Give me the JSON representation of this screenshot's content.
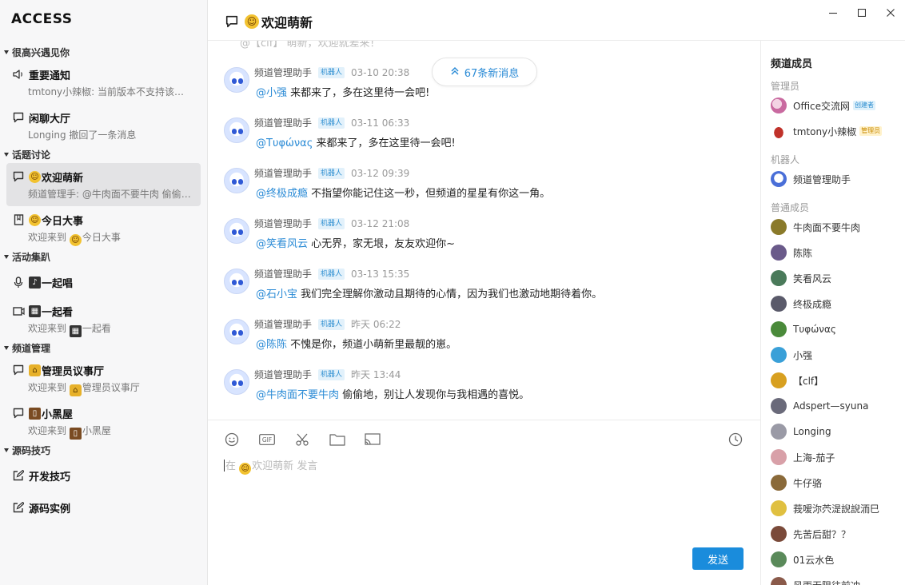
{
  "app": {
    "title": "ACCESS"
  },
  "sidebar": {
    "groups": [
      {
        "title": "很高兴遇见你",
        "channels": [
          {
            "name": "重要通知",
            "sub": "tmtony小辣椒: 当前版本不支持该消息类型，请使用最新版本..."
          },
          {
            "name": "闲聊大厅",
            "sub": "Longing 撤回了一条消息"
          }
        ]
      },
      {
        "title": "话题讨论",
        "channels": [
          {
            "name": "欢迎萌新",
            "sub": "频道管理手: @牛肉面不要牛肉 偷偷地，别让人发现你与我相遇的喜悦。"
          },
          {
            "name": "今日大事",
            "sub_prefix": "欢迎来到",
            "sub_name": "今日大事"
          }
        ]
      },
      {
        "title": "活动集趴",
        "channels": [
          {
            "name": "一起唱"
          },
          {
            "name": "一起看",
            "sub_prefix": "欢迎来到",
            "sub_name": "一起看"
          }
        ]
      },
      {
        "title": "频道管理",
        "channels": [
          {
            "name": "管理员议事厅",
            "sub_prefix": "欢迎来到",
            "sub_name": "管理员议事厅"
          },
          {
            "name": "小黑屋",
            "sub_prefix": "欢迎来到",
            "sub_name": "小黑屋"
          }
        ]
      },
      {
        "title": "源码技巧",
        "channels": [
          {
            "name": "开发技巧"
          },
          {
            "name": "源码实例"
          }
        ]
      }
    ]
  },
  "header": {
    "title": "欢迎萌新"
  },
  "messages": {
    "top_fade": "@【clf】 萌新，欢迎就差来！",
    "new_messages_label": "67条新消息",
    "items": [
      {
        "sender": "频道管理助手",
        "badge": "机器人",
        "time": "03-10 20:38",
        "mention": "@小强",
        "text": " 来都来了，多在这里待一会吧!"
      },
      {
        "sender": "频道管理助手",
        "badge": "机器人",
        "time": "03-11 06:33",
        "mention": "@Τυφώνας",
        "text": " 来都来了，多在这里待一会吧!"
      },
      {
        "sender": "频道管理助手",
        "badge": "机器人",
        "time": "03-12 09:39",
        "mention": "@终极成瘾",
        "text": " 不指望你能记住这一秒，但频道的星星有你这一角。"
      },
      {
        "sender": "频道管理助手",
        "badge": "机器人",
        "time": "03-12 21:08",
        "mention": "@笑看风云",
        "text": " 心无界，家无垠，友友欢迎你~"
      },
      {
        "sender": "频道管理助手",
        "badge": "机器人",
        "time": "03-13 15:35",
        "mention": "@石小宝",
        "text": " 我们完全理解你激动且期待的心情，因为我们也激动地期待着你。"
      },
      {
        "sender": "频道管理助手",
        "badge": "机器人",
        "time": "昨天 06:22",
        "mention": "@陈陈",
        "text": " 不愧是你，频道小萌新里最靓的崽。"
      },
      {
        "sender": "频道管理助手",
        "badge": "机器人",
        "time": "昨天 13:44",
        "mention": "@牛肉面不要牛肉",
        "text": " 偷偷地，别让人发现你与我相遇的喜悦。"
      }
    ]
  },
  "composer": {
    "placeholder_prefix": "在",
    "placeholder_channel": "欢迎萌新",
    "placeholder_suffix": "发言",
    "send_label": "发送"
  },
  "members": {
    "title": "频道成员",
    "admins_label": "管理员",
    "bots_label": "机器人",
    "regular_label": "普通成员",
    "admins": [
      {
        "name": "Office交流网",
        "role": "创建者",
        "color": "#c96aa0"
      },
      {
        "name": "tmtony小辣椒",
        "role": "管理员",
        "color": "#c0322a"
      }
    ],
    "bots": [
      {
        "name": "频道管理助手",
        "color": "#4a6fd8"
      }
    ],
    "regular": [
      {
        "name": "牛肉面不要牛肉",
        "color": "#8a7a2a"
      },
      {
        "name": "陈陈",
        "color": "#6a5a8a"
      },
      {
        "name": "笑看风云",
        "color": "#4a7a5a"
      },
      {
        "name": "终极成瘾",
        "color": "#5a5a6a"
      },
      {
        "name": "Τυφώνας",
        "color": "#4a8a3a"
      },
      {
        "name": "小强",
        "color": "#3aa0d8"
      },
      {
        "name": "【clf】",
        "color": "#d8a020"
      },
      {
        "name": "Adspert—syuna",
        "color": "#6a6a7a"
      },
      {
        "name": "Longing",
        "color": "#9a9aa6"
      },
      {
        "name": "上海-茄子",
        "color": "#d8a0a8"
      },
      {
        "name": "牛仔骆",
        "color": "#8a6a3a"
      },
      {
        "name": "莪嗳沵茓湜誽誽洏巳",
        "color": "#e0c040"
      },
      {
        "name": "先苦后甜？？",
        "color": "#7a4a3a"
      },
      {
        "name": "01云水色",
        "color": "#5a8a5a"
      },
      {
        "name": "风雨无阻往前冲",
        "color": "#8a5a4a"
      }
    ]
  },
  "colors": {
    "accent": "#1a8cdc",
    "mention": "#2b8bd6",
    "active_bg": "#e3e3e5"
  }
}
